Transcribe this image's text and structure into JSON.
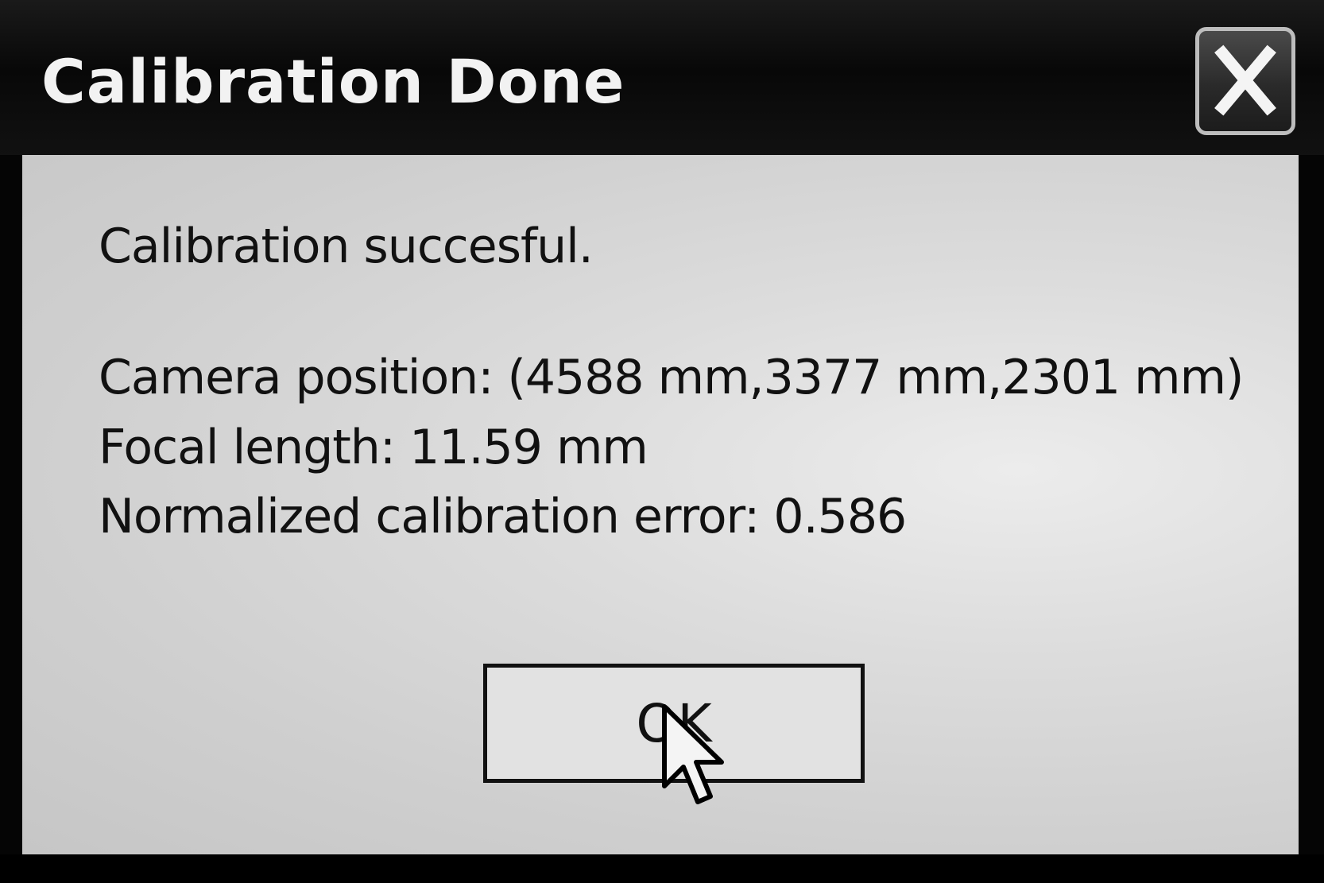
{
  "dialog": {
    "title": "Calibration Done",
    "close_icon": "close-icon",
    "message": {
      "status": "Calibration succesful.",
      "camera_position": "Camera position: (4588 mm,3377 mm,2301 mm)",
      "focal_length": "Focal length: 11.59 mm",
      "calibration_error": "Normalized calibration error: 0.586"
    },
    "ok_label": "OK",
    "cursor_icon": "mouse-pointer-icon"
  }
}
